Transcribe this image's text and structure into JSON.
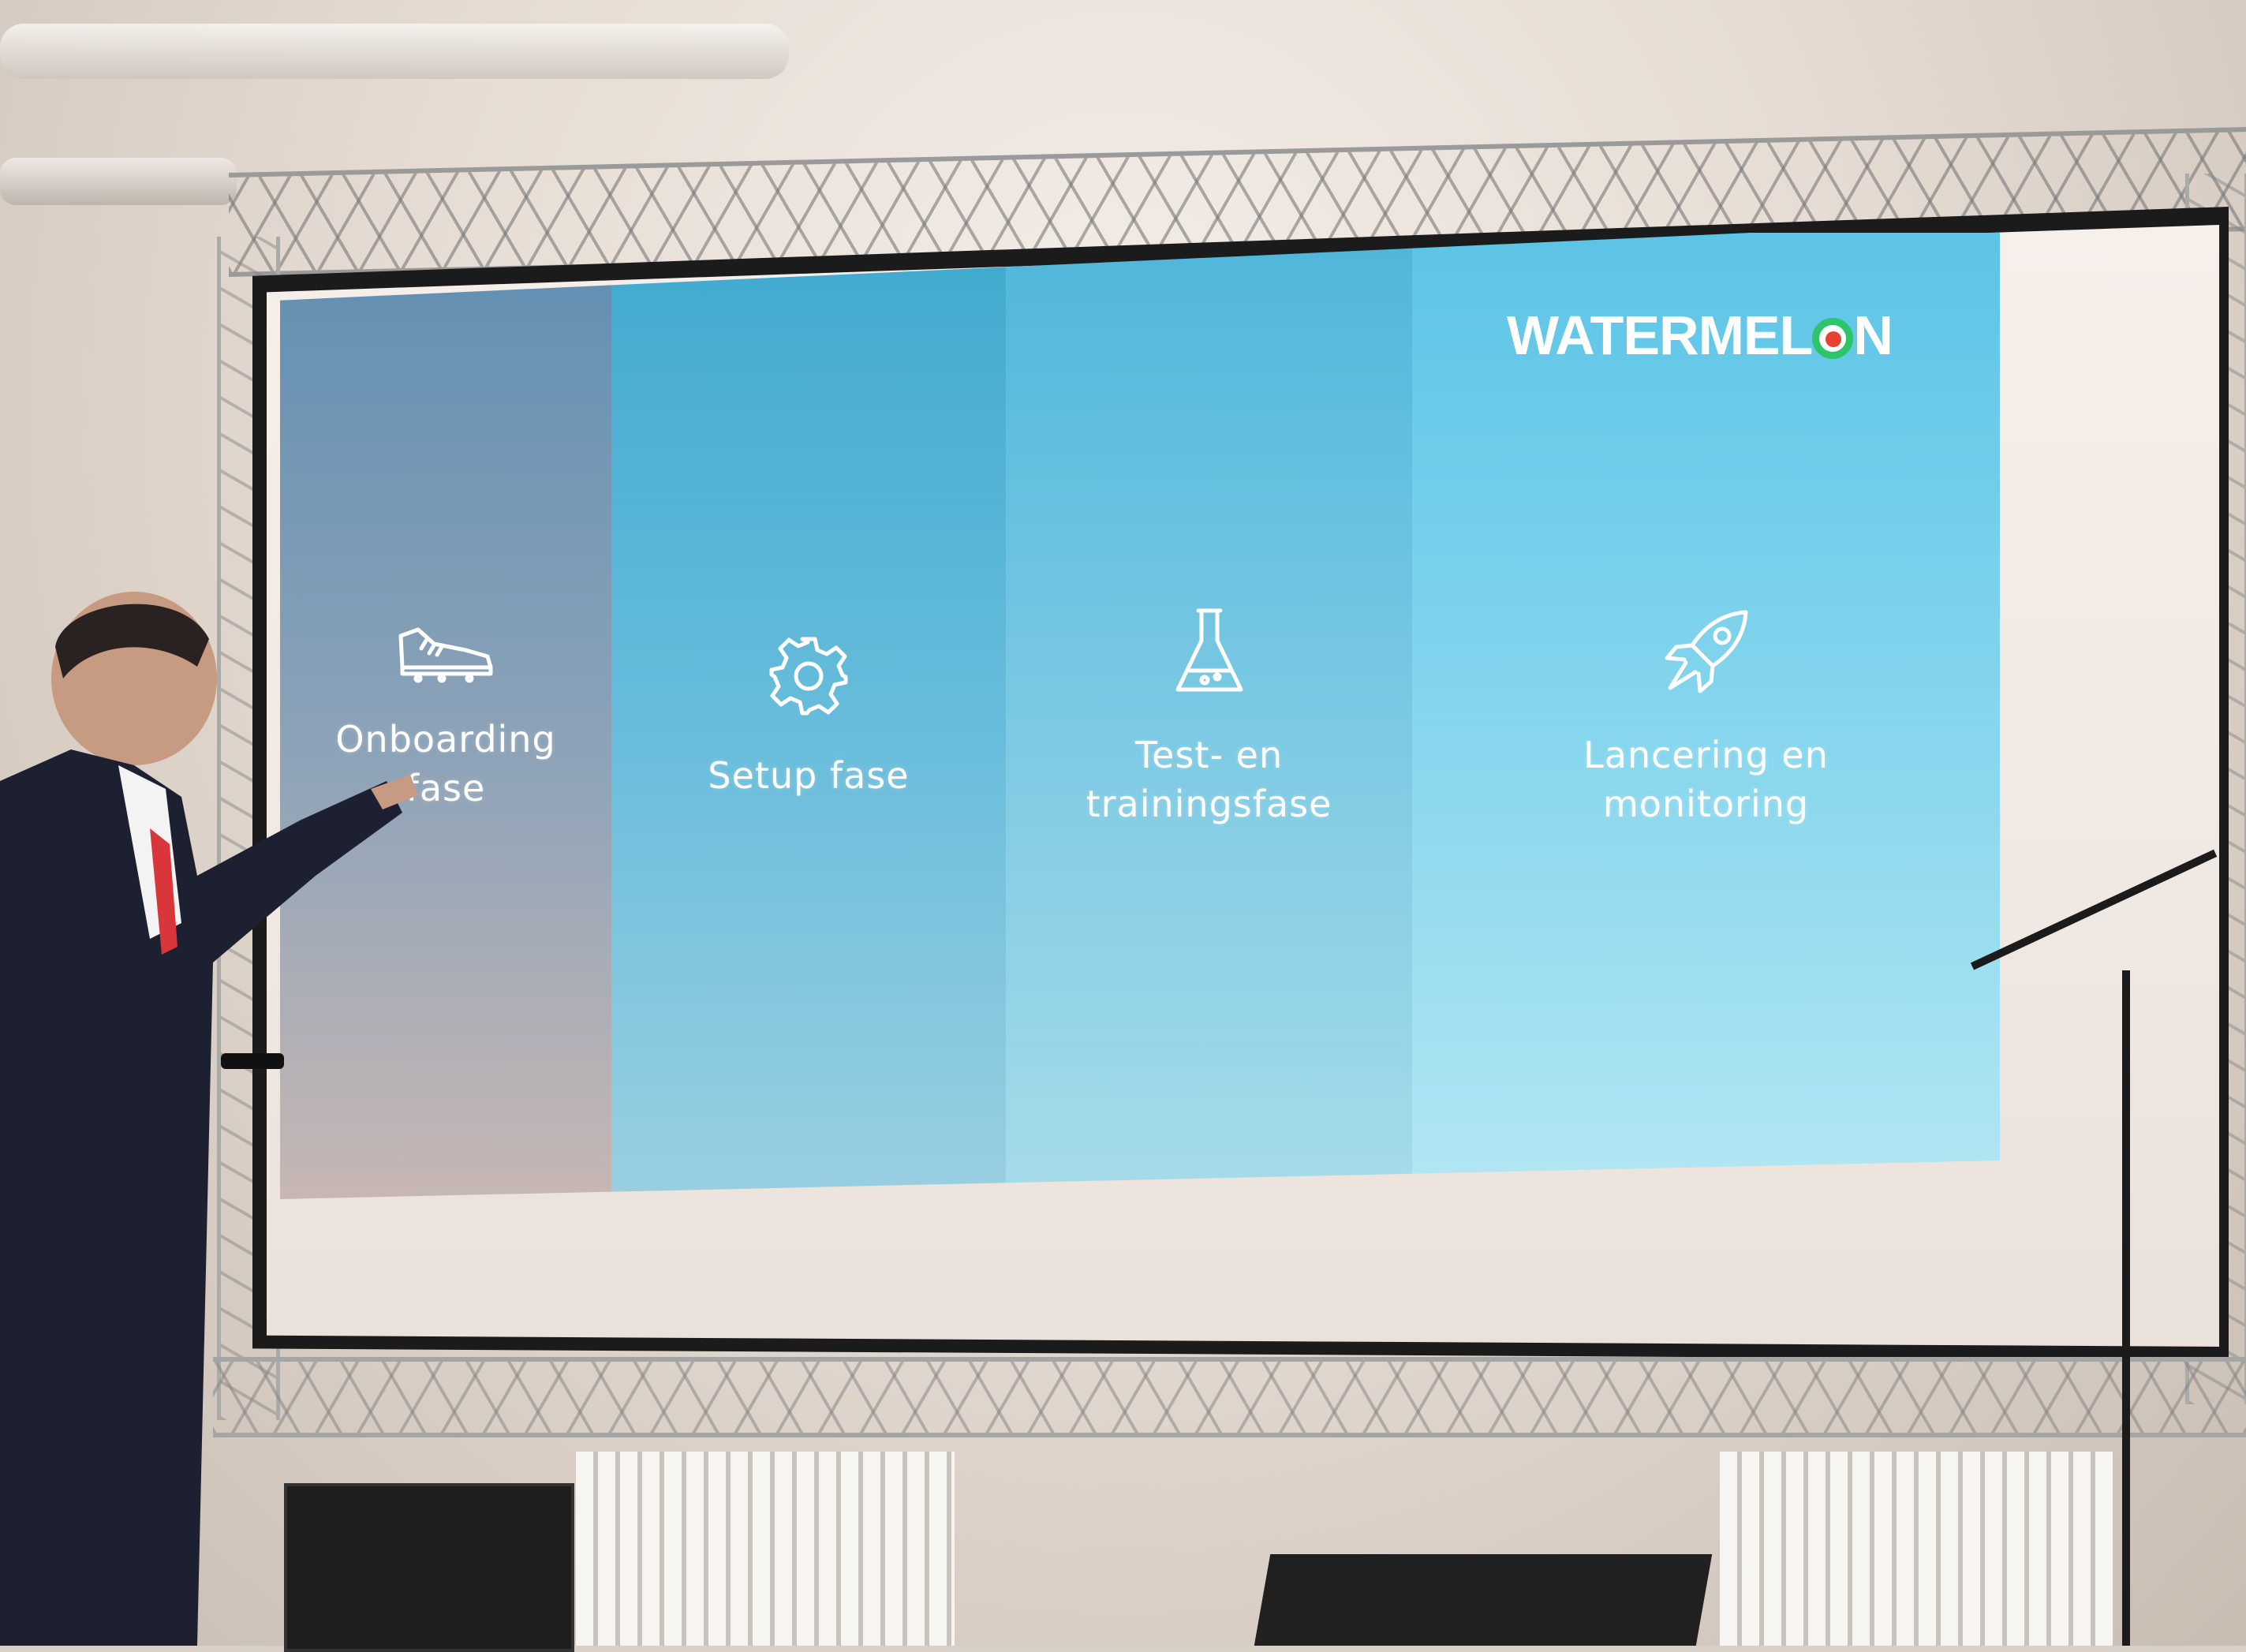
{
  "slide": {
    "logo": "WATERMEL",
    "logo_tail": "N",
    "phases": [
      {
        "icon": "sneaker-icon",
        "label_line1": "Onboarding",
        "label_line2": "fase"
      },
      {
        "icon": "gear-icon",
        "label_line1": "Setup fase",
        "label_line2": ""
      },
      {
        "icon": "flask-icon",
        "label_line1": "Test- en",
        "label_line2": "trainingsfase"
      },
      {
        "icon": "rocket-icon",
        "label_line1": "Lancering en",
        "label_line2": "monitoring"
      }
    ]
  },
  "colors": {
    "logo_ring": "#2cc56a",
    "logo_dot": "#e8412f",
    "column_1": "#5f8eb2",
    "column_2": "#3fa9cf",
    "column_3": "#4fb6da",
    "column_4": "#5cc4e6"
  }
}
